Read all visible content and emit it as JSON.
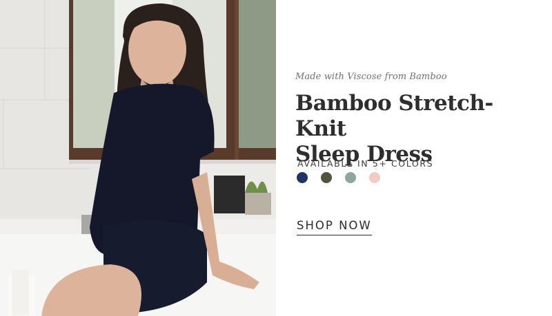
{
  "hero": {
    "eyebrow": "Made with Viscose from Bamboo",
    "title_line1": "Bamboo Stretch-Knit",
    "title_line2": "Sleep Dress",
    "availability": "AVAILABLE IN 5+ COLORS",
    "cta_label": "SHOP NOW"
  },
  "swatches": [
    {
      "name": "navy",
      "color": "#1f3462"
    },
    {
      "name": "olive",
      "color": "#4f553d"
    },
    {
      "name": "sage",
      "color": "#8ea69f"
    },
    {
      "name": "blush",
      "color": "#f3c9c3"
    }
  ],
  "colors": {
    "background": "#ffffff",
    "text": "#2e2e2e",
    "subtle_text": "#6f6f6f"
  }
}
